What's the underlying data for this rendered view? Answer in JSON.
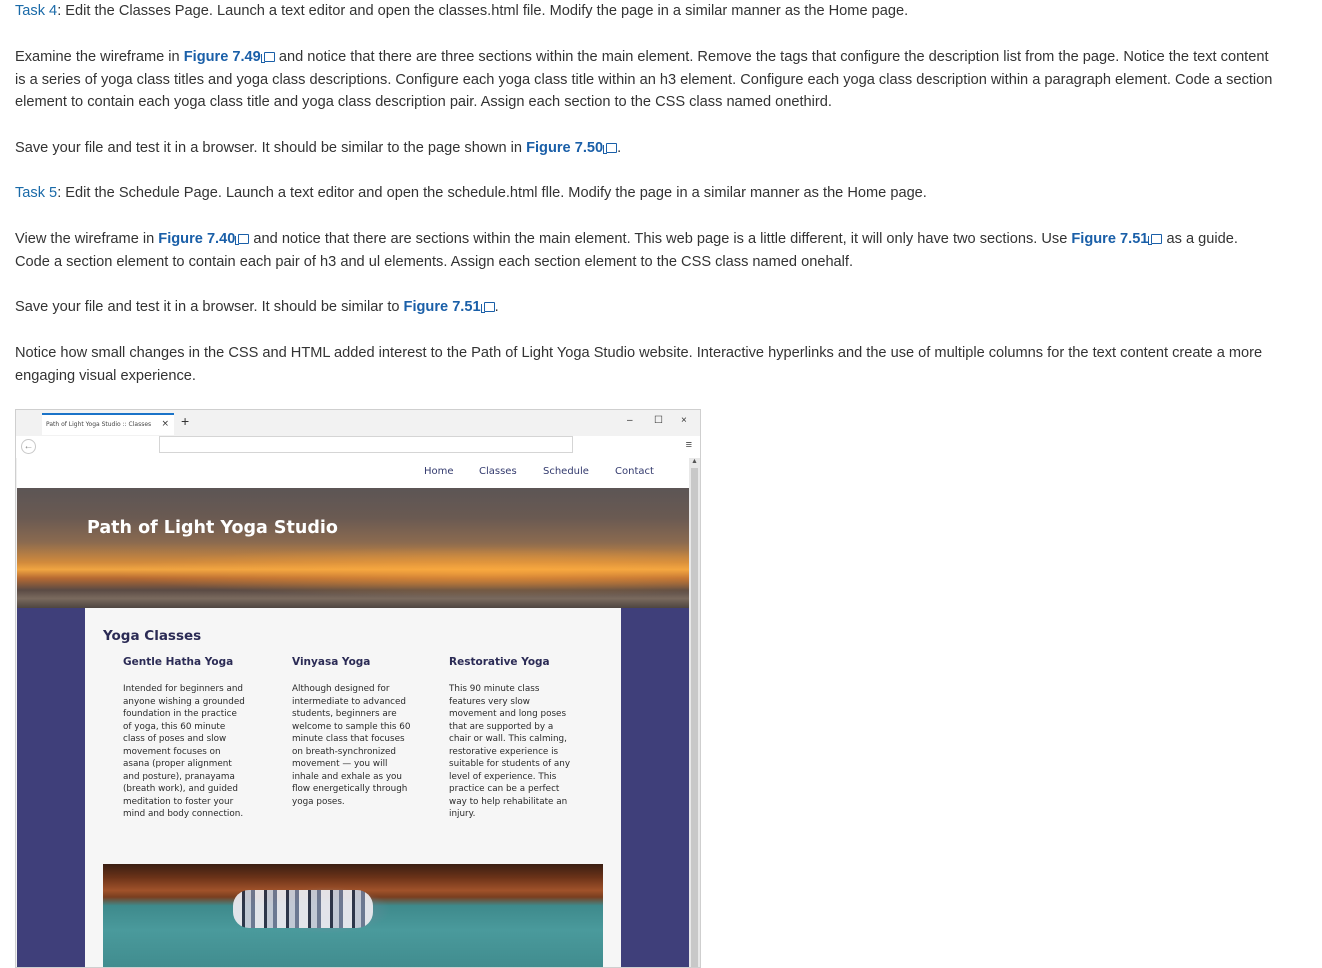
{
  "task4": {
    "label": "Task 4",
    "text": ": Edit the Classes Page. Launch a text editor and open the classes.html file. Modify the page in a similar manner as the Home page."
  },
  "para2": {
    "t1": "Examine the wireframe in ",
    "link1": "Figure 7.49",
    "t2": " and notice that there are three sections within the main element. Remove the tags that configure the description list from the page. Notice the text content is a series of yoga class titles and yoga class descriptions. Configure each yoga class title within an h3 element. Configure each yoga class description within a paragraph element. Code a section element to contain each yoga class title and yoga class description pair. Assign each section to the CSS class named onethird."
  },
  "para3": {
    "t1": "Save your file and test it in a browser. It should be similar to the page shown in ",
    "link1": "Figure 7.50",
    "t2": "."
  },
  "task5": {
    "label": "Task 5",
    "text": ": Edit the Schedule Page. Launch a text editor and open the schedule.html flle. Modify the page in a similar manner as the Home page."
  },
  "para5": {
    "t1": "View the wireframe in ",
    "link1": "Figure 7.40",
    "t2": " and notice that there are sections within the main element. This web page is a little different, it will only have two sections. Use ",
    "link2": "Figure 7.51",
    "t3": " as a guide. Code a section element to contain each pair of h3 and ul elements. Assign each section element to the CSS class named onehalf."
  },
  "para6": {
    "t1": "Save your file and test it in a browser. It should be similar to ",
    "link1": "Figure 7.51",
    "t2": "."
  },
  "para7": {
    "text": "Notice how small changes in the CSS and HTML added interest to the Path of Light Yoga Studio website. Interactive hyperlinks and the use of multiple columns for the text content create a more engaging visual experience."
  },
  "figure": {
    "tab_title": "Path of Light Yoga Studio :: Classes",
    "tab_close": "×",
    "tab_new": "+",
    "win_min": "–",
    "win_max": "☐",
    "win_close": "×",
    "back": "←",
    "menu": "≡",
    "nav": [
      "Home",
      "Classes",
      "Schedule",
      "Contact"
    ],
    "site_title": "Path of Light Yoga Studio",
    "heading": "Yoga Classes",
    "classes": [
      {
        "title": "Gentle Hatha Yoga",
        "desc": "Intended for beginners and anyone wishing a grounded foundation in the practice of yoga, this 60 minute class of poses and slow movement focuses on asana (proper alignment and posture), pranayama (breath work), and guided meditation to foster your mind and body connection."
      },
      {
        "title": "Vinyasa Yoga",
        "desc": "Although designed for intermediate to advanced students, beginners are welcome to sample this 60 minute class that focuses on breath-synchronized movement — you will inhale and exhale as you flow energetically through yoga poses."
      },
      {
        "title": "Restorative Yoga",
        "desc": "This 90 minute class features very slow movement and long poses that are supported by a chair or wall. This calming, restorative experience is suitable for students of any level of experience. This practice can be a perfect way to help rehabilitate an injury."
      }
    ],
    "colors": {
      "nav_link": "#333a6e",
      "page_bg": "#3f3f7a",
      "heading": "#2b2b55",
      "link": "#1a5fa8"
    }
  }
}
